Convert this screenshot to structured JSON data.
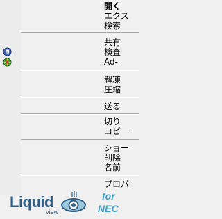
{
  "menu": {
    "items": [
      {
        "label": "開く",
        "bold": true
      },
      {
        "label": "エクス"
      },
      {
        "label": "検索"
      },
      {
        "label": "共有"
      },
      {
        "label": "検査"
      },
      {
        "label": "Ad-"
      },
      {
        "label": "解凍"
      },
      {
        "label": "圧縮"
      },
      {
        "label": "送る"
      },
      {
        "label": "切り"
      },
      {
        "label": "コピー"
      },
      {
        "label": "ショー"
      },
      {
        "label": "削除"
      },
      {
        "label": "名前"
      },
      {
        "label": "プロパ"
      }
    ]
  },
  "logo": {
    "brand": "Liquid",
    "sub": "view",
    "for": "for",
    "vendor": "NEC"
  },
  "colors": {
    "menu_bg": "#f0f0f0",
    "logo_blue": "#2f5f86",
    "logo_accent": "#3da0c4"
  },
  "icons": [
    "scanner-icon",
    "shield-globe-icon"
  ]
}
